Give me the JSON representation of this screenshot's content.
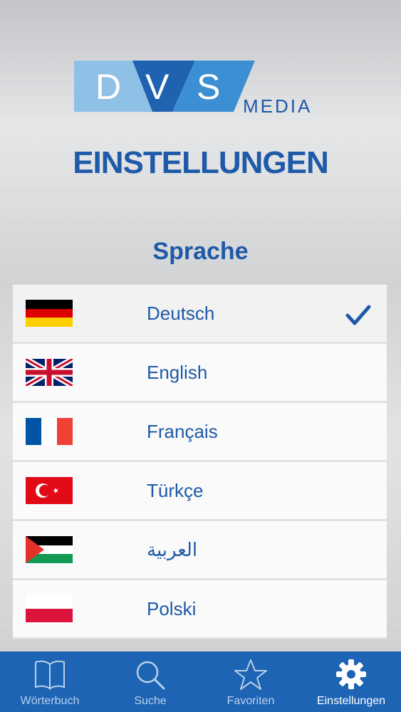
{
  "logo": {
    "letters": [
      "D",
      "V",
      "S"
    ],
    "subtitle": "MEDIA"
  },
  "page_title": "EINSTELLUNGEN",
  "section_title": "Sprache",
  "languages": [
    {
      "label": "Deutsch",
      "flag": "germany-flag",
      "selected": true
    },
    {
      "label": "English",
      "flag": "uk-flag",
      "selected": false
    },
    {
      "label": "Français",
      "flag": "france-flag",
      "selected": false
    },
    {
      "label": "Türkçe",
      "flag": "turkey-flag",
      "selected": false
    },
    {
      "label": "العربية",
      "flag": "palestine-flag",
      "selected": false
    },
    {
      "label": "Polski",
      "flag": "poland-flag",
      "selected": false
    }
  ],
  "tabs": [
    {
      "label": "Wörterbuch",
      "icon": "book-icon",
      "active": false
    },
    {
      "label": "Suche",
      "icon": "search-icon",
      "active": false
    },
    {
      "label": "Favoriten",
      "icon": "star-icon",
      "active": false
    },
    {
      "label": "Einstellungen",
      "icon": "gear-icon",
      "active": true
    }
  ],
  "colors": {
    "accent": "#1e5aa8",
    "tabbar": "#1e64b4",
    "logo_light": "#8fc0e6",
    "logo_dark": "#1f62b0"
  }
}
